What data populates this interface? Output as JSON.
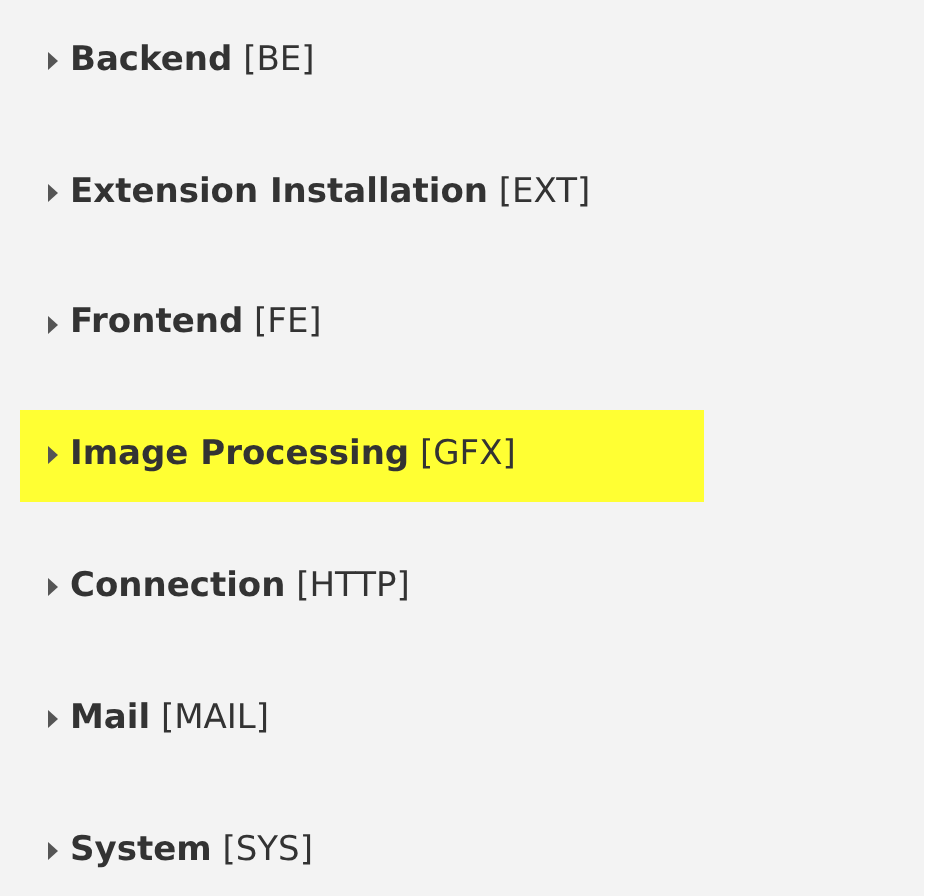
{
  "items": [
    {
      "label": "**Backend** [BE]",
      "selected": false
    },
    {
      "label": "**Extension Installation** [EXT]",
      "selected": false
    },
    {
      "label": "**Frontend** [FE]",
      "selected": false
    },
    {
      "label": "**Image Processing** [GFX]",
      "selected": true
    },
    {
      "label": "**Connection** [HTTP]",
      "selected": false
    },
    {
      "label": "**Mail** [MAIL]",
      "selected": false
    },
    {
      "label": "**System** [SYS]",
      "selected": false
    }
  ]
}
